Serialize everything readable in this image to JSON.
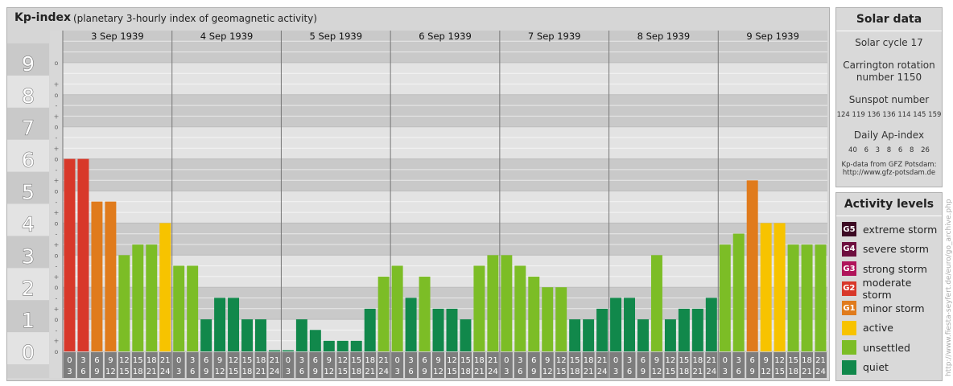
{
  "chart_data": {
    "type": "bar",
    "title": "Kp-index",
    "subtitle": "(planetary 3-hourly index of geomagnetic activity)",
    "ylim": [
      0,
      9
    ],
    "y_major_ticks": [
      "0",
      "1",
      "2",
      "3",
      "4",
      "5",
      "6",
      "7",
      "8",
      "9"
    ],
    "y_minor_ticks": [
      "o",
      "+",
      "-"
    ],
    "days": [
      "3 Sep 1939",
      "4 Sep 1939",
      "5 Sep 1939",
      "6 Sep 1939",
      "7 Sep 1939",
      "8 Sep 1939",
      "9 Sep 1939"
    ],
    "interval_labels": [
      [
        "0",
        "3"
      ],
      [
        "3",
        "6"
      ],
      [
        "6",
        "9"
      ],
      [
        "9",
        "12"
      ],
      [
        "12",
        "15"
      ],
      [
        "15",
        "18"
      ],
      [
        "18",
        "21"
      ],
      [
        "21",
        "24"
      ]
    ],
    "values": [
      6.0,
      6.0,
      4.67,
      4.67,
      3.0,
      3.33,
      3.33,
      4.0,
      2.67,
      2.67,
      1.0,
      1.67,
      1.67,
      1.0,
      1.0,
      0.0,
      0.0,
      1.0,
      0.67,
      0.33,
      0.33,
      0.33,
      1.33,
      2.33,
      2.67,
      1.67,
      2.33,
      1.33,
      1.33,
      1.0,
      2.67,
      3.0,
      3.0,
      2.67,
      2.33,
      2.0,
      2.0,
      1.0,
      1.0,
      1.33,
      1.67,
      1.67,
      1.0,
      3.0,
      1.0,
      1.33,
      1.33,
      1.67,
      3.33,
      3.67,
      5.33,
      4.0,
      4.0,
      3.33,
      3.33,
      3.33
    ],
    "grid": true,
    "legend_placement": "right"
  },
  "colors": {
    "quiet": "#11884b",
    "unsettled": "#7cbd26",
    "active": "#f7c300",
    "minor_storm": "#e07b1c",
    "moderate_storm": "#d8382a",
    "strong_storm": "#b0145a",
    "severe_storm": "#6d0e3e",
    "extreme_storm": "#3c0a23"
  },
  "solar_data": {
    "heading": "Solar data",
    "solar_cycle": "Solar cycle 17",
    "carrington_line1": "Carrington rotation",
    "carrington_line2": "number 1150",
    "sunspot_heading": "Sunspot number",
    "sunspot_values": "124 119 136 136 114 145 159",
    "ap_heading": "Daily Ap-index",
    "ap_values": "40  6  3  8  6  8  26",
    "credit_line1": "Kp-data from GFZ Potsdam:",
    "credit_line2": "http://www.gfz-potsdam.de"
  },
  "activity_levels": {
    "heading": "Activity levels",
    "items": [
      {
        "badge": "G5",
        "label": "extreme storm",
        "color": "#3c0a23"
      },
      {
        "badge": "G4",
        "label": "severe storm",
        "color": "#6d0e3e"
      },
      {
        "badge": "G3",
        "label": "strong storm",
        "color": "#b0145a"
      },
      {
        "badge": "G2",
        "label": "moderate storm",
        "color": "#d8382a"
      },
      {
        "badge": "G1",
        "label": "minor storm",
        "color": "#e07b1c"
      },
      {
        "badge": "",
        "label": "active",
        "color": "#f7c300"
      },
      {
        "badge": "",
        "label": "unsettled",
        "color": "#7cbd26"
      },
      {
        "badge": "",
        "label": "quiet",
        "color": "#11884b"
      }
    ]
  },
  "watermark": "http://www.fiesta-seyfert.de/euro/go_archive.php"
}
